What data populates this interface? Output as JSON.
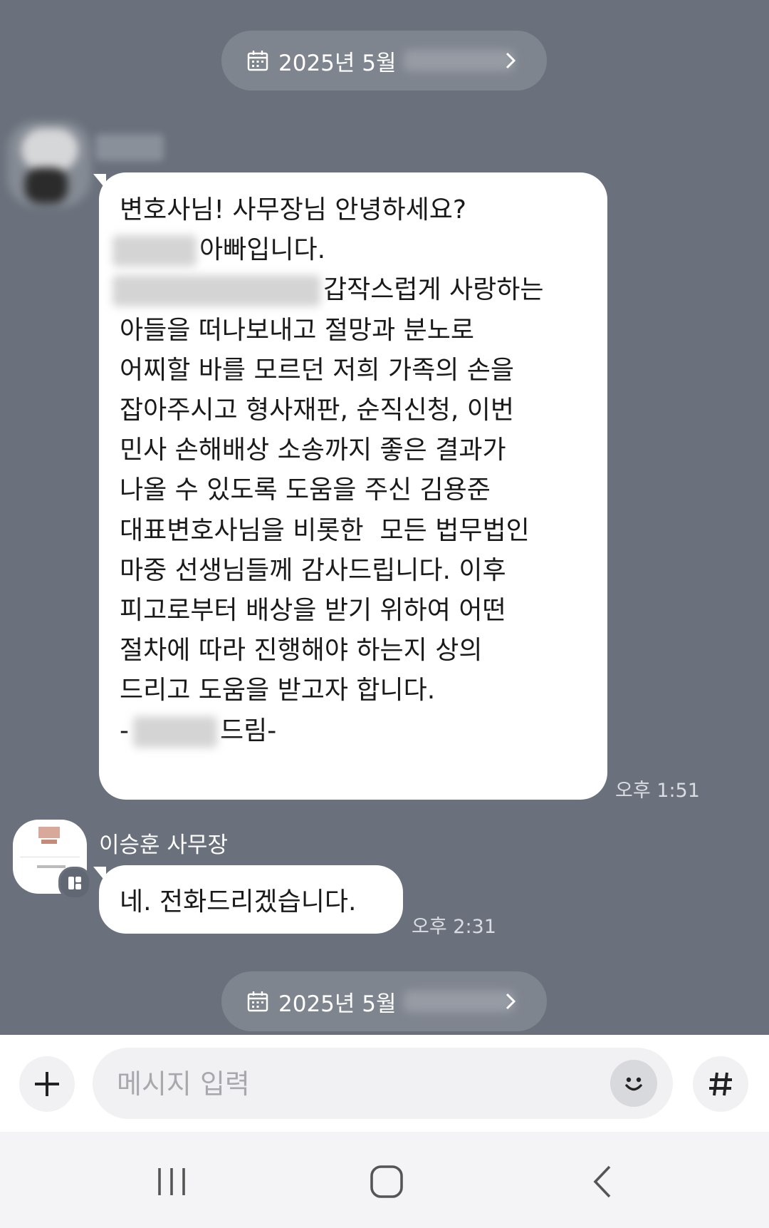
{
  "date_dividers": [
    {
      "label": "2025년 5월",
      "icon": "calendar-icon"
    },
    {
      "label": "2025년 5월",
      "icon": "calendar-icon"
    }
  ],
  "messages": [
    {
      "lines": [
        {
          "text": "변호사님! 사무장님 안녕하세요?"
        },
        {
          "text": "아빠입니다."
        },
        {
          "text": "갑작스럽게 사랑하는"
        },
        {
          "text": "아들을 떠나보내고 절망과 분노로"
        },
        {
          "text": "어찌할 바를 모르던 저희 가족의 손을"
        },
        {
          "text": "잡아주시고 형사재판, 순직신청, 이번"
        },
        {
          "text": "민사 손해배상 소송까지 좋은 결과가"
        },
        {
          "text": "나올 수 있도록 도움을 주신 김용준"
        },
        {
          "text": "대표변호사님을 비롯한  모든 법무법인"
        },
        {
          "text": "마중 선생님들께 감사드립니다. 이후"
        },
        {
          "text": "피고로부터 배상을 받기 위하여 어떤"
        },
        {
          "text": "절차에 따라 진행해야 하는지 상의"
        },
        {
          "text": "드리고 도움을 받고자 합니다."
        },
        {
          "text_prefix": "-",
          "text": "드림-"
        }
      ],
      "time": "오후 1:51"
    },
    {
      "sender": "이승훈 사무장",
      "text": "네. 전화드리겠습니다.",
      "time": "오후 2:31"
    }
  ],
  "input": {
    "placeholder": "메시지 입력"
  },
  "colors": {
    "chat_bg": "#6a717c",
    "bubble": "#ffffff",
    "pill": "#7f858f"
  }
}
